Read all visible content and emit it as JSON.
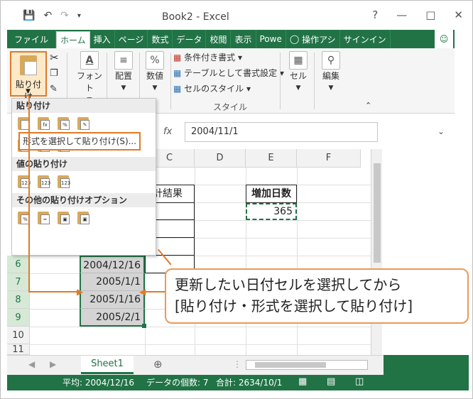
{
  "window": {
    "title": "Book2 - Excel",
    "controls": [
      "?",
      "—",
      "□",
      "✕"
    ]
  },
  "tabs": [
    "ファイル",
    "ホーム",
    "挿入",
    "ページ",
    "数式",
    "データ",
    "校閲",
    "表示",
    "Powe",
    "操作アシ",
    "サインイン"
  ],
  "ribbon": {
    "paste_label": "貼り付け",
    "font_label": "フォント",
    "align_label": "配置",
    "number_label": "数値",
    "cond_format": "条件付き書式",
    "table_format": "テーブルとして書式設定",
    "cell_style": "セルのスタイル",
    "style_group": "スタイル",
    "cells_label": "セル",
    "edit_label": "編集"
  },
  "paste_menu": {
    "section1": "貼り付け",
    "section2": "値の貼り付け",
    "section3": "その他の貼り付けオプション",
    "paste_special": "形式を選択して貼り付け(S)...",
    "value_icon_text": "123"
  },
  "formula_bar": {
    "fx": "fx",
    "value": "2004/11/1"
  },
  "columns": [
    "C",
    "D",
    "E",
    "F"
  ],
  "rows": [
    "6",
    "7",
    "8",
    "9",
    "10",
    "11"
  ],
  "cells": {
    "c_header": "計結果",
    "e_header": "増加日数",
    "e_value": "365",
    "b_values": [
      "2004/12/16",
      "2005/1/1",
      "2005/1/16",
      "2005/2/1"
    ]
  },
  "sheet_tab": "Sheet1",
  "status": {
    "average": "平均: 2004/12/16",
    "count": "データの個数: 7",
    "sum": "合計: 2634/10/1"
  },
  "callout": {
    "line1": "更新したい日付セルを選択してから",
    "line2": "[貼り付け・形式を選択して貼り付け]"
  }
}
